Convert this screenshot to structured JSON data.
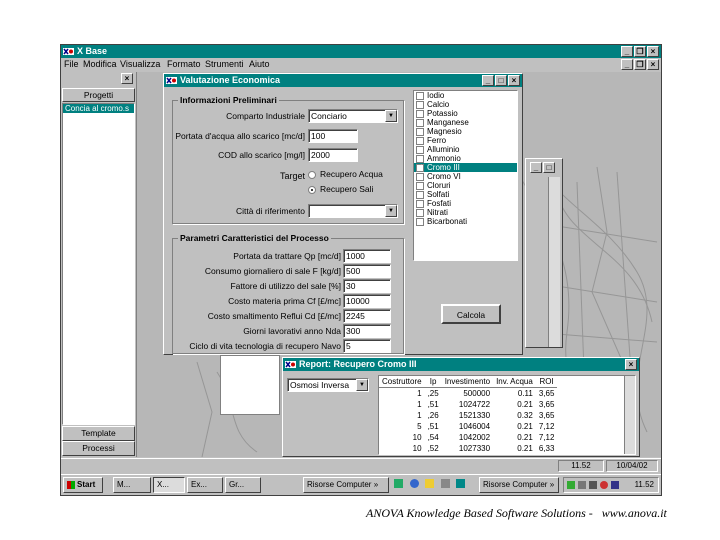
{
  "main_window": {
    "title": "X Base",
    "menu": [
      "File",
      "Modifica",
      "Visualizza",
      "Formato",
      "Strumenti",
      "Aiuto"
    ],
    "caption_buttons": [
      "_",
      "❐",
      "×"
    ]
  },
  "left_panel": {
    "close": "×",
    "header": "Progetti",
    "items": [
      "Concia al cromo.s"
    ],
    "bottom_buttons": [
      "Template",
      "Processi"
    ]
  },
  "dialog": {
    "title": "Valutazione Economica",
    "caption_buttons": [
      "_",
      "□",
      "×"
    ],
    "info_group": {
      "title": "Informazioni Preliminari",
      "comparto_label": "Comparto Industriale",
      "comparto_value": "Conciario",
      "portata_label": "Portata d'acqua allo scarico [mc/d]",
      "portata_value": "100",
      "cod_label": "COD allo scarico [mg/l]",
      "cod_value": "2000",
      "target_label": "Target",
      "target_options": [
        "Recupero Acqua",
        "Recupero Sali"
      ],
      "target_selected": 1,
      "citta_label": "Città di riferimento",
      "citta_value": ""
    },
    "params_group": {
      "title": "Parametri Caratteristici del Processo",
      "rows": [
        {
          "label": "Portata da trattare Qp [mc/d]",
          "value": "1000"
        },
        {
          "label": "Consumo giornaliero di sale F [kg/d]",
          "value": "500"
        },
        {
          "label": "Fattore di utilizzo del sale [%]",
          "value": "30"
        },
        {
          "label": "Costo materia prima Cf [£/mc]",
          "value": "10000"
        },
        {
          "label": "Costo smaltimento Reflui Cd [£/mc]",
          "value": "2245"
        },
        {
          "label": "Giorni lavorativi anno Nda",
          "value": "300"
        },
        {
          "label": "Ciclo di vita tecnologia di recupero Navo",
          "value": "5"
        }
      ]
    },
    "checklist": [
      {
        "label": "Iodio",
        "checked": false
      },
      {
        "label": "Calcio",
        "checked": false
      },
      {
        "label": "Potassio",
        "checked": false
      },
      {
        "label": "Manganese",
        "checked": false
      },
      {
        "label": "Magnesio",
        "checked": false
      },
      {
        "label": "Ferro",
        "checked": false
      },
      {
        "label": "Alluminio",
        "checked": false
      },
      {
        "label": "Ammonio",
        "checked": false
      },
      {
        "label": "Cromo III",
        "checked": true
      },
      {
        "label": "Cromo VI",
        "checked": false
      },
      {
        "label": "Cloruri",
        "checked": false
      },
      {
        "label": "Solfati",
        "checked": false
      },
      {
        "label": "Fosfati",
        "checked": false
      },
      {
        "label": "Nitrati",
        "checked": false
      },
      {
        "label": "Bicarbonati",
        "checked": false
      }
    ],
    "calc_button": "Calcola"
  },
  "report": {
    "title": "Report: Recupero Cromo III",
    "combo_value": "Osmosi Inversa",
    "columns": [
      "Costruttore",
      "Ip",
      "Investimento",
      "Inv. Acqua",
      "ROI"
    ],
    "rows": [
      [
        "1",
        ",25",
        "500000",
        "0.11",
        "3,65"
      ],
      [
        "1",
        ",51",
        "1024722",
        "0.21",
        "3,65"
      ],
      [
        "1",
        ",26",
        "1521330",
        "0.32",
        "3,65"
      ],
      [
        "5",
        ",51",
        "1046004",
        "0.21",
        "7,12"
      ],
      [
        "10",
        ",54",
        "1042002",
        "0.21",
        "7,12"
      ],
      [
        "10",
        ",52",
        "1027330",
        "0.21",
        "6,33"
      ]
    ]
  },
  "status_bar": {
    "time": "11.52",
    "date": "10/04/02"
  },
  "taskbar": {
    "start": "Start",
    "buttons": [
      "M...",
      "X...",
      "Ex...",
      "Gr..."
    ],
    "task2": "Risorse Computer",
    "task3": "Risorse Computer",
    "more": "»",
    "clock": "11.52"
  },
  "footer": "ANOVA Knowledge Based Software Solutions -   www.anova.it",
  "colors": {
    "titlebar": "#008080",
    "face": "#c0c0c0",
    "desktop": "#b7b7b7",
    "footer_text": "#000000"
  }
}
